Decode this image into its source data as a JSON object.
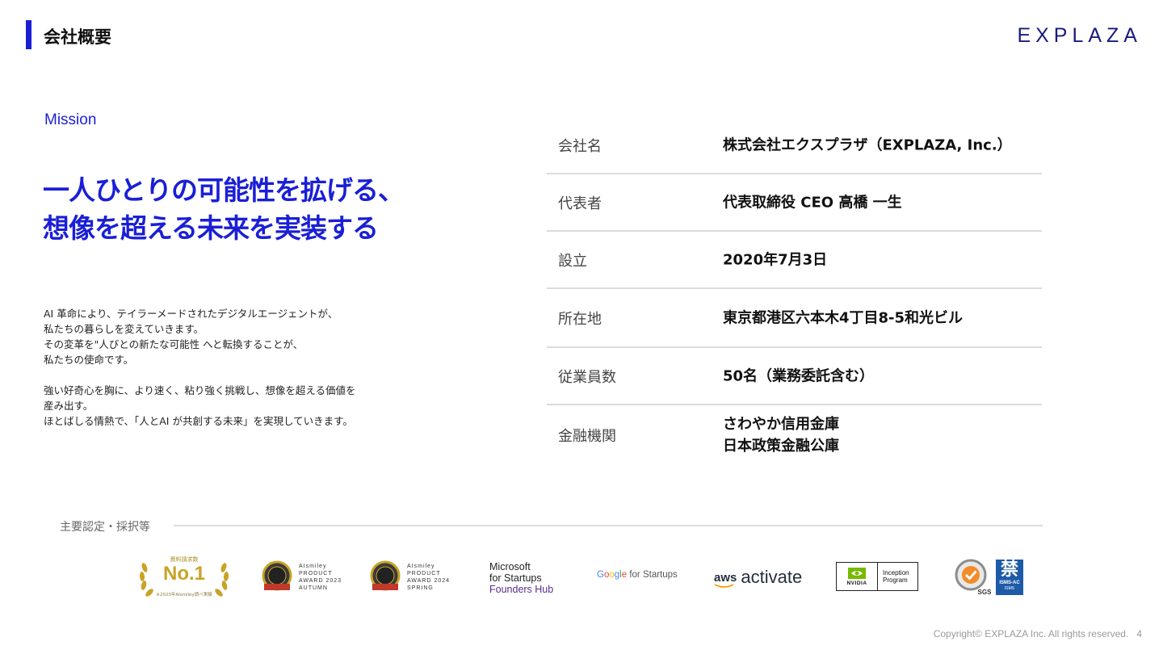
{
  "header": {
    "title": "会社概要",
    "brand": "EXPLAZA",
    "accent_color": "#1a1fd6"
  },
  "mission": {
    "label": "Mission",
    "heading_lines": [
      "一人ひとりの可能性を拡げる、",
      "想像を超える未来を実装する"
    ],
    "body_lines": [
      "AI 革命により、テイラーメードされたデジタルエージェントが、",
      "私たちの暮らしを変えていきます。",
      "その変革を\"人びとの新たな可能性 へと転換することが、",
      "私たちの使命です。",
      "",
      "強い好奇心を胸に、より速く、粘り強く挑戦し、想像を超える価値を",
      "産み出す。",
      "ほとばしる情熱で、「人とAI が共創する未来」を実現していきます。"
    ]
  },
  "company_info": [
    {
      "label": "会社名",
      "value": "株式会社エクスプラザ（EXPLAZA, Inc.）"
    },
    {
      "label": "代表者",
      "value": "代表取締役 CEO  高橋 一生"
    },
    {
      "label": "設立",
      "value": "2020年7月3日"
    },
    {
      "label": "所在地",
      "value": "東京都港区六本木4丁目8-5和光ビル"
    },
    {
      "label": "従業員数",
      "value": "50名（業務委託含む）"
    },
    {
      "label": "金融機関",
      "value_lines": [
        "さわやか信用金庫",
        "日本政策金融公庫"
      ]
    }
  ],
  "certifications": {
    "label": "主要認定・採択等",
    "laurel": {
      "top": "資料請求数",
      "main": "No.1",
      "foot": "※2023年AIsmiley調べ実績",
      "color": "#c9a227"
    },
    "award_autumn": {
      "lines": [
        "AIsmiley",
        "PRODUCT",
        "AWARD 2023",
        "AUTUMN"
      ],
      "medal_text": "2023秋"
    },
    "award_spring": {
      "lines": [
        "AIsmiley",
        "PRODUCT",
        "AWARD 2024",
        "SPRING"
      ],
      "medal_text": "2024春"
    },
    "microsoft": {
      "lines": [
        "Microsoft",
        "for Startups"
      ],
      "sub": "Founders Hub"
    },
    "google": {
      "g1": "G",
      "g2": "o",
      "g3": "o",
      "g4": "g",
      "g5": "l",
      "g6": "e",
      "rest": " for Startups"
    },
    "aws": {
      "word": "aws",
      "product": "activate"
    },
    "nvidia": {
      "name": "NVIDIA",
      "lines": [
        "Inception",
        "Program"
      ]
    },
    "sgs": {
      "label": "SGS",
      "isms_lines": [
        "ISMS-AC",
        "ISMS"
      ]
    }
  },
  "footer": {
    "copyright": "Copyright© EXPLAZA Inc.  All rights reserved.",
    "page": "4"
  }
}
